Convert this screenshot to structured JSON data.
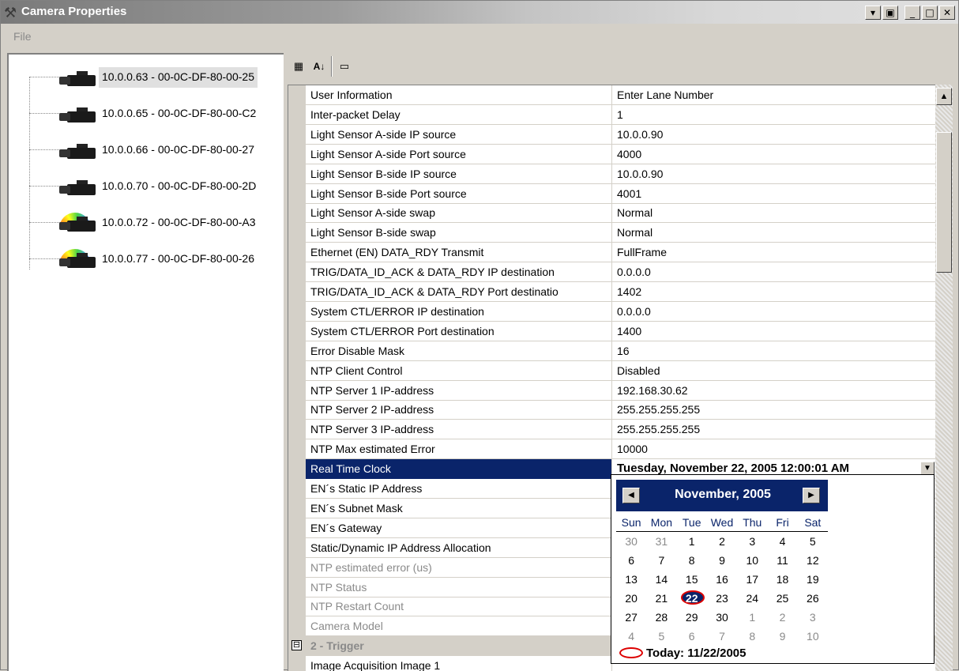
{
  "window": {
    "title": "Camera Properties",
    "icon": "tools-icon"
  },
  "menu": {
    "file": "File"
  },
  "tree": {
    "items": [
      {
        "label": "10.0.0.63 - 00-0C-DF-80-00-25",
        "icon": "camera-icon",
        "selected": true
      },
      {
        "label": "10.0.0.65 - 00-0C-DF-80-00-C2",
        "icon": "camera-icon"
      },
      {
        "label": "10.0.0.66 - 00-0C-DF-80-00-27",
        "icon": "camera-icon"
      },
      {
        "label": "10.0.0.70 - 00-0C-DF-80-00-2D",
        "icon": "camera-icon"
      },
      {
        "label": "10.0.0.72 - 00-0C-DF-80-00-A3",
        "icon": "camera-rainbow-icon"
      },
      {
        "label": "10.0.0.77 - 00-0C-DF-80-00-26",
        "icon": "camera-rainbow-icon"
      }
    ]
  },
  "toolbar": {
    "categorized_icon": "categorized-icon",
    "alphabetical_icon": "sort-az-icon",
    "property_pages_icon": "property-pages-icon"
  },
  "properties": [
    {
      "name": "User Information",
      "value": "Enter Lane Number"
    },
    {
      "name": "Inter-packet Delay",
      "value": "1"
    },
    {
      "name": "Light Sensor A-side IP source",
      "value": "10.0.0.90"
    },
    {
      "name": "Light Sensor A-side Port source",
      "value": "4000"
    },
    {
      "name": "Light Sensor B-side IP source",
      "value": "10.0.0.90"
    },
    {
      "name": "Light Sensor B-side Port source",
      "value": "4001"
    },
    {
      "name": "Light Sensor A-side swap",
      "value": "Normal"
    },
    {
      "name": "Light Sensor B-side swap",
      "value": "Normal"
    },
    {
      "name": "Ethernet (EN) DATA_RDY Transmit",
      "value": "FullFrame"
    },
    {
      "name": "TRIG/DATA_ID_ACK & DATA_RDY IP destination",
      "value": "0.0.0.0"
    },
    {
      "name": "TRIG/DATA_ID_ACK & DATA_RDY Port destinatio",
      "value": "1402"
    },
    {
      "name": "System CTL/ERROR IP destination",
      "value": "0.0.0.0"
    },
    {
      "name": "System CTL/ERROR Port destination",
      "value": "1400"
    },
    {
      "name": "Error Disable Mask",
      "value": "16"
    },
    {
      "name": "NTP Client Control",
      "value": "Disabled"
    },
    {
      "name": "NTP Server 1 IP-address",
      "value": "192.168.30.62"
    },
    {
      "name": "NTP Server 2 IP-address",
      "value": "255.255.255.255"
    },
    {
      "name": "NTP Server 3 IP-address",
      "value": "255.255.255.255"
    },
    {
      "name": "NTP Max estimated Error",
      "value": "10000"
    },
    {
      "name": "Real Time Clock",
      "value": "Tuesday, November 22, 2005 12:00:01 AM",
      "selected": true
    },
    {
      "name": "EN´s Static IP Address",
      "value": ""
    },
    {
      "name": "EN´s Subnet Mask",
      "value": ""
    },
    {
      "name": "EN´s Gateway",
      "value": ""
    },
    {
      "name": "Static/Dynamic IP Address Allocation",
      "value": ""
    },
    {
      "name": "NTP estimated error (us)",
      "value": "",
      "disabled": true
    },
    {
      "name": "NTP Status",
      "value": "",
      "disabled": true
    },
    {
      "name": "NTP Restart Count",
      "value": "",
      "disabled": true
    },
    {
      "name": "Camera Model",
      "value": "",
      "disabled": true
    }
  ],
  "category": {
    "toggle": "⊟",
    "label": "2 - Trigger"
  },
  "last_row": {
    "name": "Image Acquisition Image 1",
    "value": ""
  },
  "calendar": {
    "month_label": "November, 2005",
    "prev": "◀",
    "next": "▶",
    "dows": [
      "Sun",
      "Mon",
      "Tue",
      "Wed",
      "Thu",
      "Fri",
      "Sat"
    ],
    "weeks": [
      [
        {
          "d": "30",
          "o": true
        },
        {
          "d": "31",
          "o": true
        },
        {
          "d": "1"
        },
        {
          "d": "2"
        },
        {
          "d": "3"
        },
        {
          "d": "4"
        },
        {
          "d": "5"
        }
      ],
      [
        {
          "d": "6"
        },
        {
          "d": "7"
        },
        {
          "d": "8"
        },
        {
          "d": "9"
        },
        {
          "d": "10"
        },
        {
          "d": "11"
        },
        {
          "d": "12"
        }
      ],
      [
        {
          "d": "13"
        },
        {
          "d": "14"
        },
        {
          "d": "15"
        },
        {
          "d": "16"
        },
        {
          "d": "17"
        },
        {
          "d": "18"
        },
        {
          "d": "19"
        }
      ],
      [
        {
          "d": "20"
        },
        {
          "d": "21"
        },
        {
          "d": "22",
          "t": true
        },
        {
          "d": "23"
        },
        {
          "d": "24"
        },
        {
          "d": "25"
        },
        {
          "d": "26"
        }
      ],
      [
        {
          "d": "27"
        },
        {
          "d": "28"
        },
        {
          "d": "29"
        },
        {
          "d": "30"
        },
        {
          "d": "1",
          "o": true
        },
        {
          "d": "2",
          "o": true
        },
        {
          "d": "3",
          "o": true
        }
      ],
      [
        {
          "d": "4",
          "o": true
        },
        {
          "d": "5",
          "o": true
        },
        {
          "d": "6",
          "o": true
        },
        {
          "d": "7",
          "o": true
        },
        {
          "d": "8",
          "o": true
        },
        {
          "d": "9",
          "o": true
        },
        {
          "d": "10",
          "o": true
        }
      ]
    ],
    "today_label": "Today: 11/22/2005"
  },
  "colors": {
    "selection": "#0a246a",
    "face": "#d4d0c8",
    "today_ring": "#dd0000"
  }
}
